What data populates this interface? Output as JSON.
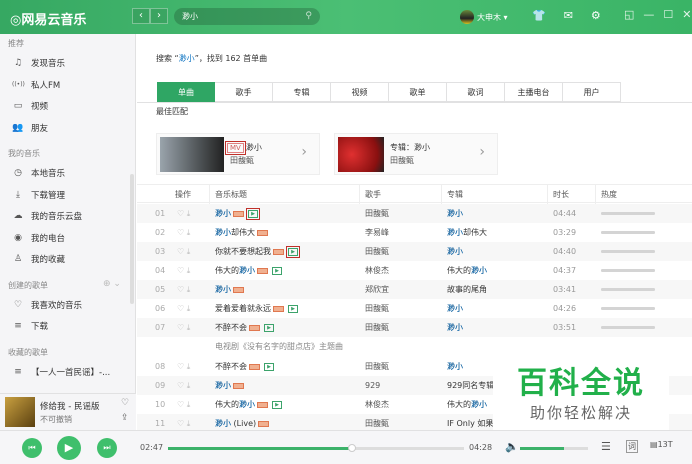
{
  "app": {
    "logo": "网易云音乐",
    "back": "‹",
    "forward": "›",
    "search_value": "渺小",
    "username": "大申木 ▾"
  },
  "sidebar": {
    "sections": [
      {
        "label": "推荐",
        "items": [
          {
            "icon": "music-note",
            "label": "发现音乐"
          },
          {
            "icon": "radio",
            "label": "私人FM"
          },
          {
            "icon": "video",
            "label": "视频"
          },
          {
            "icon": "friends",
            "label": "朋友"
          }
        ]
      },
      {
        "label": "我的音乐",
        "items": [
          {
            "icon": "local-music",
            "label": "本地音乐"
          },
          {
            "icon": "download",
            "label": "下载管理"
          },
          {
            "icon": "cloud",
            "label": "我的音乐云盘"
          },
          {
            "icon": "podcast",
            "label": "我的电台"
          },
          {
            "icon": "collection",
            "label": "我的收藏"
          }
        ]
      },
      {
        "label": "创建的歌单",
        "items": [
          {
            "icon": "heart",
            "label": "我喜欢的音乐"
          },
          {
            "icon": "playlist",
            "label": "下载"
          }
        ]
      },
      {
        "label": "收藏的歌单",
        "items": [
          {
            "icon": "playlist",
            "label": "【一人一首民谣】-..."
          }
        ]
      }
    ],
    "now_playing": {
      "title": "修给我 - 民谣版",
      "artist": "不可撤销"
    }
  },
  "main": {
    "summary_prefix": "搜索 “",
    "summary_query": "渺小",
    "summary_suffix": "”，找到 162 首单曲",
    "tabs": [
      "单曲",
      "歌手",
      "专辑",
      "视频",
      "歌单",
      "歌词",
      "主播电台",
      "用户"
    ],
    "active_tab": 0,
    "best_match_label": "最佳匹配",
    "best_mv": {
      "badge": "MV",
      "title": "渺小",
      "artist": "田馥甄"
    },
    "best_album": {
      "title": "专辑：渺小",
      "artist": "田馥甄"
    },
    "columns": [
      "操作",
      "音乐标题",
      "歌手",
      "专辑",
      "时长",
      "热度"
    ],
    "highlight": "渺小",
    "songs": [
      {
        "num": "01",
        "title": "渺小",
        "sq": true,
        "mv": true,
        "boxed": true,
        "singer": "田馥甄",
        "album": "渺小",
        "duration": "04:44",
        "heat": 1
      },
      {
        "num": "02",
        "title": "渺小却伟大",
        "sq": true,
        "mv": false,
        "singer": "李易峰",
        "album": "渺小却伟大",
        "duration": "03:29",
        "heat": 1
      },
      {
        "num": "03",
        "title": "你就不要想起我",
        "sq": true,
        "mv": true,
        "boxed": true,
        "singer": "田馥甄",
        "album": "渺小",
        "duration": "04:40",
        "heat": 1
      },
      {
        "num": "04",
        "title": "伟大的渺小",
        "sq": true,
        "mv": true,
        "singer": "林俊杰",
        "album": "伟大的渺小",
        "duration": "04:37",
        "heat": 1
      },
      {
        "num": "05",
        "title": "渺小",
        "sq": true,
        "mv": false,
        "singer": "郑欣宜",
        "album": "故事的尾角",
        "duration": "03:41",
        "heat": 1
      },
      {
        "num": "06",
        "title": "爱着爱着就永远",
        "sq": true,
        "mv": true,
        "singer": "田馥甄",
        "album": "渺小",
        "duration": "04:26",
        "heat": 1
      },
      {
        "num": "07",
        "title": "不醉不会",
        "sq": true,
        "mv": true,
        "singer": "田馥甄",
        "album": "渺小",
        "duration": "03:51",
        "heat": 1,
        "subtitle": "电视剧《没有名字的甜点店》主题曲"
      },
      {
        "num": "08",
        "title": "不醉不会",
        "sq": true,
        "mv": true,
        "singer": "田馥甄",
        "album": "渺小"
      },
      {
        "num": "09",
        "title": "渺小",
        "sq": true,
        "mv": false,
        "singer": "929",
        "album": "929同名专辑"
      },
      {
        "num": "10",
        "title": "伟大的渺小",
        "sq": true,
        "mv": true,
        "singer": "林俊杰",
        "album": "伟大的渺小"
      },
      {
        "num": "11",
        "title": "渺小 (Live)",
        "sq": true,
        "mv": false,
        "singer": "田馥甄",
        "album": "IF Only 如果"
      }
    ]
  },
  "watermark": {
    "title": "百科全说",
    "subtitle": "助你轻松解决"
  },
  "player": {
    "elapsed": "02:47",
    "total": "04:28",
    "progress": 0.62,
    "volume": 0.65,
    "lyric_btn": "词",
    "count": "13T"
  },
  "colors": {
    "brand": "#2fa664",
    "highlight": "#0c73c2"
  }
}
